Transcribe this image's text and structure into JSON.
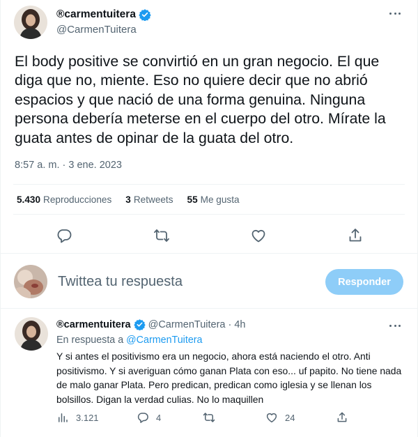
{
  "tweet": {
    "display_name": "®carmentuitera",
    "handle": "@CarmenTuitera",
    "text": "El body positive se convirtió en un gran negocio. El que diga que no, miente. Eso no quiere decir que no abrió espacios y que nació de una forma genuina. Ninguna persona debería meterse en el cuerpo del otro. Mírate la guata antes de opinar de la guata del otro.",
    "timestamp": "8:57 a. m. · 3 ene. 2023",
    "stats": [
      {
        "value": "5.430",
        "label": "Reproducciones"
      },
      {
        "value": "3",
        "label": "Retweets"
      },
      {
        "value": "55",
        "label": "Me gusta"
      }
    ],
    "action_icons": [
      "reply-icon",
      "retweet-icon",
      "like-icon",
      "share-icon"
    ]
  },
  "compose": {
    "placeholder": "Twittea tu respuesta",
    "button_label": "Responder"
  },
  "reply": {
    "display_name": "®carmentuitera",
    "handle": "@CarmenTuitera",
    "separator": "·",
    "age": "4h",
    "in_reply_prefix": "En respuesta a",
    "in_reply_handle": "@CarmenTuitera",
    "text": "Y si antes el positivismo era un negocio, ahora está naciendo el otro. Anti positivismo. Y si averiguan cómo ganan Plata con eso... uf papito. No tiene nada de malo ganar Plata. Pero predican, predican como iglesia y se llenan los bolsillos. Digan la verdad culias. No lo maquillen",
    "views": "3.121",
    "replies": "4",
    "likes": "24"
  },
  "colors": {
    "accent": "#1d9bf0",
    "muted": "#536471",
    "button_disabled": "#8ecdf8",
    "divider": "#eff3f4"
  }
}
